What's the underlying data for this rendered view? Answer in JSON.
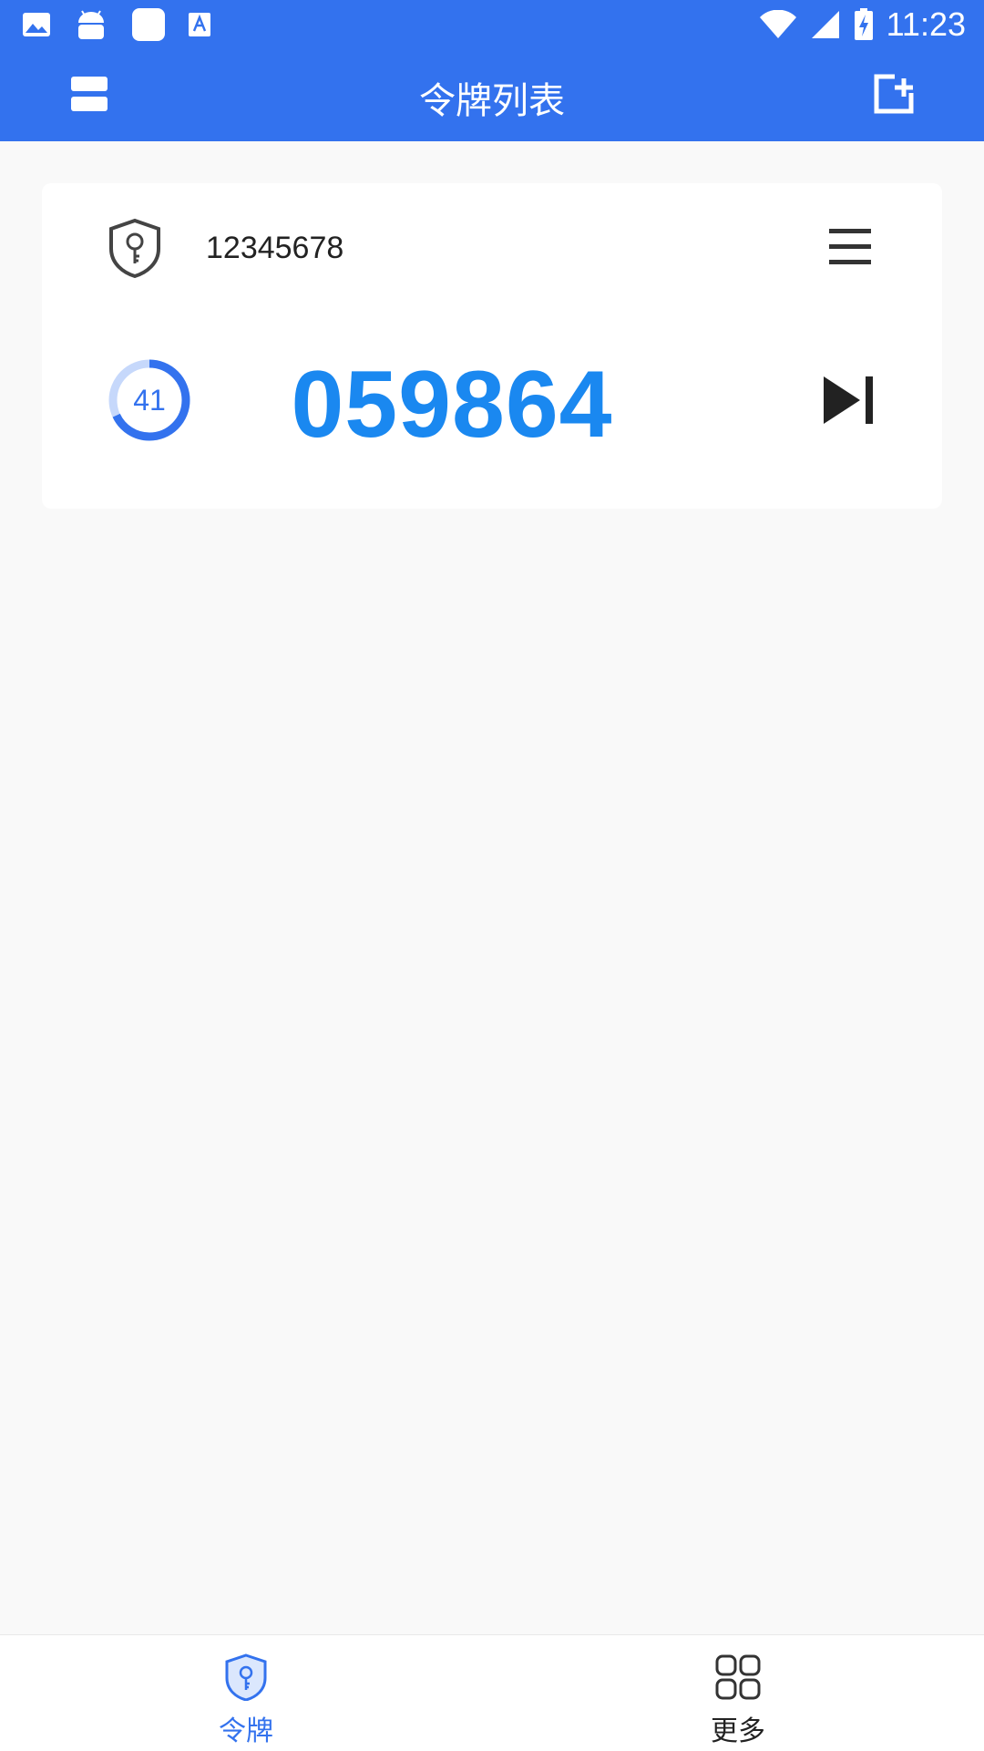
{
  "status_bar": {
    "time": "11:23"
  },
  "toolbar": {
    "title": "令牌列表",
    "left_icon": "list-icon",
    "right_icon": "add-token-icon"
  },
  "token": {
    "account": "12345678",
    "countdown": "41",
    "countdown_fraction": 0.68,
    "code": "059864"
  },
  "bottom_nav": {
    "items": [
      {
        "label": "令牌",
        "icon": "shield-key-icon",
        "active": true
      },
      {
        "label": "更多",
        "icon": "grid-icon",
        "active": false
      }
    ]
  },
  "colors": {
    "primary": "#3372ee",
    "code": "#1a88f0",
    "background": "#f9f9f9"
  }
}
